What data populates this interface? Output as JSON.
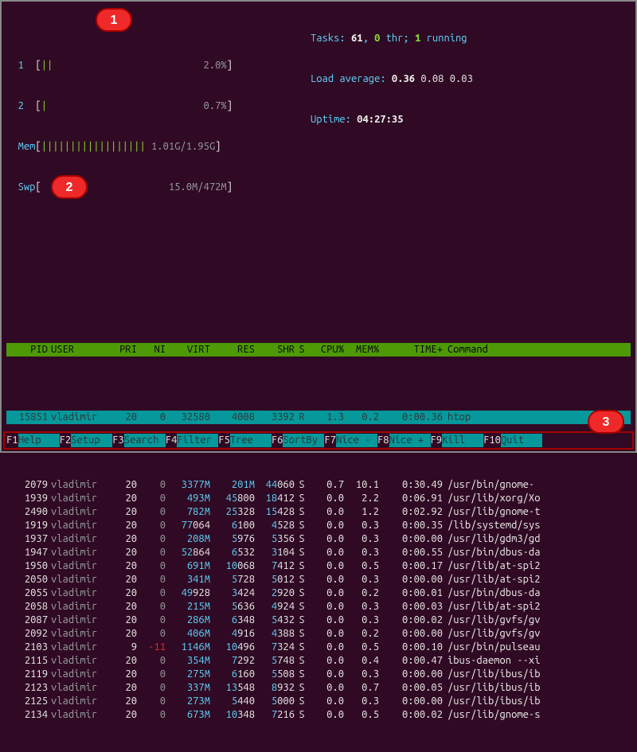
{
  "cpu_meters": [
    {
      "label": "1",
      "bars": "||",
      "text": "2.0%"
    },
    {
      "label": "2",
      "bars": "|",
      "text": "0.7%"
    }
  ],
  "mem": {
    "label": "Mem",
    "bars": "||||||||||||||||||",
    "text": "1.01G/1.95G"
  },
  "swp": {
    "label": "Swp",
    "bars": "",
    "text": "15.0M/472M"
  },
  "stats": {
    "tasks_label": "Tasks:",
    "tasks": "61",
    "thr_label": "thr;",
    "thr": "0",
    "running_label": "running",
    "running": "1",
    "la_label": "Load average:",
    "la1": "0.36",
    "la2": "0.08",
    "la3": "0.03",
    "uptime_label": "Uptime:",
    "uptime": "04:27:35"
  },
  "columns": {
    "pid": "PID",
    "user": "USER",
    "pri": "PRI",
    "ni": "NI",
    "virt": "VIRT",
    "res": "RES",
    "shr": "SHR",
    "s": "S",
    "cpu": "CPU%",
    "mem": "MEM%",
    "time": "TIME+",
    "cmd": "Command"
  },
  "selected": {
    "pid": "15851",
    "user": "vladimir",
    "pri": "20",
    "ni": "0",
    "virt": "32580",
    "res": "4008",
    "shr": "3392",
    "s": "R",
    "cpu": "1.3",
    "mem": "0.2",
    "time": "0:00.36",
    "cmd": "htop"
  },
  "procs": [
    {
      "pid": "2079",
      "user": "vladimir",
      "pri": "20",
      "ni": "0",
      "virt_c": "3377M",
      "virt_w": "",
      "res_c": "201M",
      "res_w": "",
      "shr_c": "44",
      "shr_w": "060",
      "s": "S",
      "cpu": "0.7",
      "mem": "10.1",
      "time": "0:30.49",
      "cmd": "/usr/bin/gnome-"
    },
    {
      "pid": "1939",
      "user": "vladimir",
      "pri": "20",
      "ni": "0",
      "virt_c": "493M",
      "virt_w": "",
      "res_c": "45",
      "res_w": "800",
      "shr_c": "18",
      "shr_w": "412",
      "s": "S",
      "cpu": "0.0",
      "mem": "2.2",
      "time": "0:06.91",
      "cmd": "/usr/lib/xorg/Xo"
    },
    {
      "pid": "2490",
      "user": "vladimir",
      "pri": "20",
      "ni": "0",
      "virt_c": "782M",
      "virt_w": "",
      "res_c": "25",
      "res_w": "328",
      "shr_c": "15",
      "shr_w": "428",
      "s": "S",
      "cpu": "0.0",
      "mem": "1.2",
      "time": "0:02.92",
      "cmd": "/usr/lib/gnome-t"
    },
    {
      "pid": "1919",
      "user": "vladimir",
      "pri": "20",
      "ni": "0",
      "virt_c": "77",
      "virt_w": "064",
      "res_c": "6",
      "res_w": "100",
      "shr_c": "4",
      "shr_w": "528",
      "s": "S",
      "cpu": "0.0",
      "mem": "0.3",
      "time": "0:00.35",
      "cmd": "/lib/systemd/sys"
    },
    {
      "pid": "1937",
      "user": "vladimir",
      "pri": "20",
      "ni": "0",
      "virt_c": "208M",
      "virt_w": "",
      "res_c": "5",
      "res_w": "976",
      "shr_c": "5",
      "shr_w": "356",
      "s": "S",
      "cpu": "0.0",
      "mem": "0.3",
      "time": "0:00.00",
      "cmd": "/usr/lib/gdm3/gd"
    },
    {
      "pid": "1947",
      "user": "vladimir",
      "pri": "20",
      "ni": "0",
      "virt_c": "52",
      "virt_w": "864",
      "res_c": "6",
      "res_w": "532",
      "shr_c": "3",
      "shr_w": "104",
      "s": "S",
      "cpu": "0.0",
      "mem": "0.3",
      "time": "0:00.55",
      "cmd": "/usr/bin/dbus-da"
    },
    {
      "pid": "1950",
      "user": "vladimir",
      "pri": "20",
      "ni": "0",
      "virt_c": "691M",
      "virt_w": "",
      "res_c": "10",
      "res_w": "068",
      "shr_c": "7",
      "shr_w": "412",
      "s": "S",
      "cpu": "0.0",
      "mem": "0.5",
      "time": "0:00.17",
      "cmd": "/usr/lib/at-spi2"
    },
    {
      "pid": "2050",
      "user": "vladimir",
      "pri": "20",
      "ni": "0",
      "virt_c": "341M",
      "virt_w": "",
      "res_c": "5",
      "res_w": "728",
      "shr_c": "5",
      "shr_w": "012",
      "s": "S",
      "cpu": "0.0",
      "mem": "0.3",
      "time": "0:00.00",
      "cmd": "/usr/lib/at-spi2"
    },
    {
      "pid": "2055",
      "user": "vladimir",
      "pri": "20",
      "ni": "0",
      "virt_c": "49",
      "virt_w": "928",
      "res_c": "3",
      "res_w": "424",
      "shr_c": "2",
      "shr_w": "920",
      "s": "S",
      "cpu": "0.0",
      "mem": "0.2",
      "time": "0:00.01",
      "cmd": "/usr/bin/dbus-da"
    },
    {
      "pid": "2058",
      "user": "vladimir",
      "pri": "20",
      "ni": "0",
      "virt_c": "215M",
      "virt_w": "",
      "res_c": "5",
      "res_w": "636",
      "shr_c": "4",
      "shr_w": "924",
      "s": "S",
      "cpu": "0.0",
      "mem": "0.3",
      "time": "0:00.03",
      "cmd": "/usr/lib/at-spi2"
    },
    {
      "pid": "2087",
      "user": "vladimir",
      "pri": "20",
      "ni": "0",
      "virt_c": "286M",
      "virt_w": "",
      "res_c": "6",
      "res_w": "348",
      "shr_c": "5",
      "shr_w": "432",
      "s": "S",
      "cpu": "0.0",
      "mem": "0.3",
      "time": "0:00.02",
      "cmd": "/usr/lib/gvfs/gv"
    },
    {
      "pid": "2092",
      "user": "vladimir",
      "pri": "20",
      "ni": "0",
      "virt_c": "406M",
      "virt_w": "",
      "res_c": "4",
      "res_w": "916",
      "shr_c": "4",
      "shr_w": "388",
      "s": "S",
      "cpu": "0.0",
      "mem": "0.2",
      "time": "0:00.00",
      "cmd": "/usr/lib/gvfs/gv"
    },
    {
      "pid": "2103",
      "user": "vladimir",
      "pri": "9",
      "ni": "-11",
      "virt_c": "1146M",
      "virt_w": "",
      "res_c": "10",
      "res_w": "496",
      "shr_c": "7",
      "shr_w": "324",
      "s": "S",
      "cpu": "0.0",
      "mem": "0.5",
      "time": "0:00.10",
      "cmd": "/usr/bin/pulseau"
    },
    {
      "pid": "2115",
      "user": "vladimir",
      "pri": "20",
      "ni": "0",
      "virt_c": "354M",
      "virt_w": "",
      "res_c": "7",
      "res_w": "292",
      "shr_c": "5",
      "shr_w": "748",
      "s": "S",
      "cpu": "0.0",
      "mem": "0.4",
      "time": "0:00.47",
      "cmd": "ibus-daemon --xi"
    },
    {
      "pid": "2119",
      "user": "vladimir",
      "pri": "20",
      "ni": "0",
      "virt_c": "275M",
      "virt_w": "",
      "res_c": "6",
      "res_w": "160",
      "shr_c": "5",
      "shr_w": "508",
      "s": "S",
      "cpu": "0.0",
      "mem": "0.3",
      "time": "0:00.00",
      "cmd": "/usr/lib/ibus/ib"
    },
    {
      "pid": "2123",
      "user": "vladimir",
      "pri": "20",
      "ni": "0",
      "virt_c": "337M",
      "virt_w": "",
      "res_c": "13",
      "res_w": "548",
      "shr_c": "8",
      "shr_w": "932",
      "s": "S",
      "cpu": "0.0",
      "mem": "0.7",
      "time": "0:00.05",
      "cmd": "/usr/lib/ibus/ib"
    },
    {
      "pid": "2125",
      "user": "vladimir",
      "pri": "20",
      "ni": "0",
      "virt_c": "273M",
      "virt_w": "",
      "res_c": "5",
      "res_w": "440",
      "shr_c": "5",
      "shr_w": "000",
      "s": "S",
      "cpu": "0.0",
      "mem": "0.3",
      "time": "0:00.00",
      "cmd": "/usr/lib/ibus/ib"
    },
    {
      "pid": "2134",
      "user": "vladimir",
      "pri": "20",
      "ni": "0",
      "virt_c": "673M",
      "virt_w": "",
      "res_c": "10",
      "res_w": "348",
      "shr_c": "7",
      "shr_w": "216",
      "s": "S",
      "cpu": "0.0",
      "mem": "0.5",
      "time": "0:00.02",
      "cmd": "/usr/lib/gnome-s"
    }
  ],
  "fkeys": [
    {
      "key": "F1",
      "label": "Help  "
    },
    {
      "key": "F2",
      "label": "Setup "
    },
    {
      "key": "F3",
      "label": "Search"
    },
    {
      "key": "F4",
      "label": "Filter"
    },
    {
      "key": "F5",
      "label": "Tree  "
    },
    {
      "key": "F6",
      "label": "SortBy"
    },
    {
      "key": "F7",
      "label": "Nice -"
    },
    {
      "key": "F8",
      "label": "Nice +"
    },
    {
      "key": "F9",
      "label": "Kill  "
    },
    {
      "key": "F10",
      "label": "Quit "
    }
  ],
  "badges": {
    "b1": "1",
    "b2": "2",
    "b3": "3"
  }
}
